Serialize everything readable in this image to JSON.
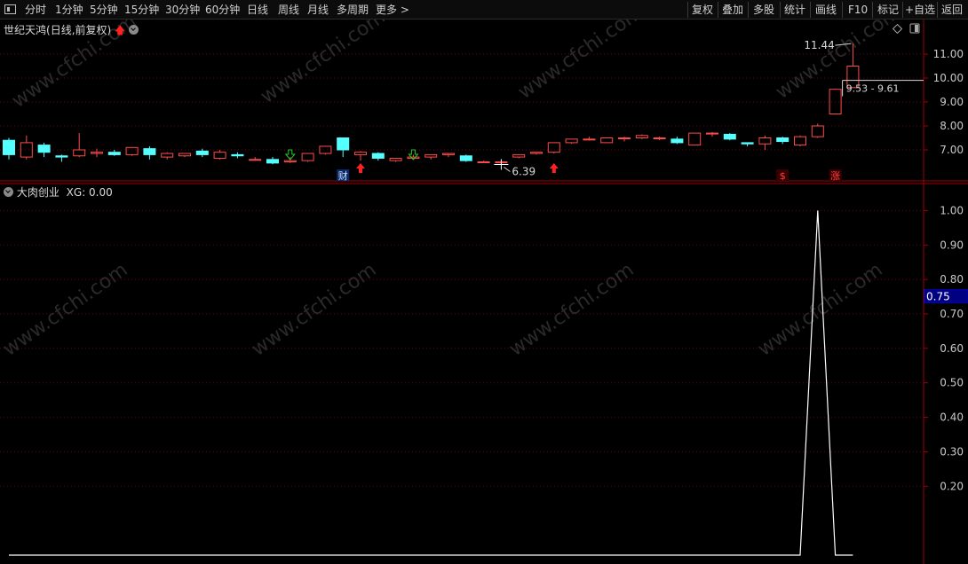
{
  "toolbar": {
    "items": [
      "分时",
      "1分钟",
      "5分钟",
      "15分钟",
      "30分钟",
      "60分钟",
      "日线",
      "周线",
      "月线",
      "多周期",
      "更多 >"
    ],
    "right_items": [
      "复权",
      "叠加",
      "多股",
      "统计",
      "画线",
      "F10",
      "标记",
      "+自选",
      "返回"
    ]
  },
  "main_panel": {
    "stock_name": "世纪天鸿",
    "period_label": "(日线,前复权)",
    "high_label": "11.44",
    "low_label": "6.39",
    "range_label": "9.53 - 9.61",
    "badge_cai": "财",
    "badge_dollar": "$",
    "badge_zhang": "涨"
  },
  "sub_panel": {
    "indicator_name": "大肉创业",
    "indicator_value": "XG: 0.00",
    "current_value_label": "0.75"
  },
  "watermark": "www.cfchi.com",
  "colors": {
    "up": "#ff4a4a",
    "down": "#54ffff",
    "line": "#ffffff",
    "axis": "#a0000a",
    "grid": "#6a0010"
  },
  "chart_data": [
    {
      "type": "candlestick",
      "title": "世纪天鸿(日线,前复权)",
      "ylim": [
        6.0,
        12.0
      ],
      "yticks": [
        "7.00",
        "8.00",
        "9.00",
        "10.00",
        "11.00"
      ],
      "annotations": [
        "11.44",
        "6.39",
        "9.53 - 9.61"
      ],
      "series": [
        {
          "o": 7.4,
          "h": 7.5,
          "l": 6.6,
          "c": 6.8
        },
        {
          "o": 6.7,
          "h": 7.6,
          "l": 6.6,
          "c": 7.3
        },
        {
          "o": 7.2,
          "h": 7.3,
          "l": 6.7,
          "c": 6.9
        },
        {
          "o": 6.75,
          "h": 6.8,
          "l": 6.5,
          "c": 6.7
        },
        {
          "o": 6.75,
          "h": 7.7,
          "l": 6.7,
          "c": 7.0
        },
        {
          "o": 6.85,
          "h": 7.05,
          "l": 6.7,
          "c": 6.9
        },
        {
          "o": 6.9,
          "h": 7.0,
          "l": 6.75,
          "c": 6.8
        },
        {
          "o": 6.8,
          "h": 7.1,
          "l": 6.75,
          "c": 7.1
        },
        {
          "o": 7.05,
          "h": 7.15,
          "l": 6.6,
          "c": 6.8
        },
        {
          "o": 6.7,
          "h": 6.9,
          "l": 6.6,
          "c": 6.85
        },
        {
          "o": 6.75,
          "h": 6.85,
          "l": 6.7,
          "c": 6.85
        },
        {
          "o": 6.95,
          "h": 7.05,
          "l": 6.7,
          "c": 6.8
        },
        {
          "o": 6.65,
          "h": 7.0,
          "l": 6.6,
          "c": 6.9
        },
        {
          "o": 6.8,
          "h": 6.9,
          "l": 6.65,
          "c": 6.75
        },
        {
          "o": 6.6,
          "h": 6.7,
          "l": 6.55,
          "c": 6.6
        },
        {
          "o": 6.6,
          "h": 6.7,
          "l": 6.4,
          "c": 6.45
        },
        {
          "o": 6.5,
          "h": 6.7,
          "l": 6.45,
          "c": 6.55
        },
        {
          "o": 6.55,
          "h": 6.85,
          "l": 6.5,
          "c": 6.85
        },
        {
          "o": 6.85,
          "h": 7.15,
          "l": 6.8,
          "c": 7.15
        },
        {
          "o": 7.5,
          "h": 7.5,
          "l": 6.7,
          "c": 7.0
        },
        {
          "o": 6.8,
          "h": 6.95,
          "l": 6.55,
          "c": 6.9
        },
        {
          "o": 6.85,
          "h": 6.9,
          "l": 6.55,
          "c": 6.65
        },
        {
          "o": 6.55,
          "h": 6.65,
          "l": 6.5,
          "c": 6.65
        },
        {
          "o": 6.65,
          "h": 6.8,
          "l": 6.6,
          "c": 6.7
        },
        {
          "o": 6.7,
          "h": 6.8,
          "l": 6.6,
          "c": 6.8
        },
        {
          "o": 6.8,
          "h": 6.85,
          "l": 6.7,
          "c": 6.85
        },
        {
          "o": 6.75,
          "h": 6.8,
          "l": 6.5,
          "c": 6.55
        },
        {
          "o": 6.5,
          "h": 6.55,
          "l": 6.45,
          "c": 6.5
        },
        {
          "o": 6.5,
          "h": 6.6,
          "l": 6.39,
          "c": 6.5
        },
        {
          "o": 6.7,
          "h": 6.8,
          "l": 6.65,
          "c": 6.8
        },
        {
          "o": 6.85,
          "h": 6.9,
          "l": 6.8,
          "c": 6.9
        },
        {
          "o": 6.9,
          "h": 7.3,
          "l": 6.85,
          "c": 7.3
        },
        {
          "o": 7.3,
          "h": 7.45,
          "l": 7.25,
          "c": 7.45
        },
        {
          "o": 7.45,
          "h": 7.55,
          "l": 7.4,
          "c": 7.45
        },
        {
          "o": 7.3,
          "h": 7.5,
          "l": 7.3,
          "c": 7.5
        },
        {
          "o": 7.5,
          "h": 7.55,
          "l": 7.35,
          "c": 7.5
        },
        {
          "o": 7.5,
          "h": 7.65,
          "l": 7.45,
          "c": 7.6
        },
        {
          "o": 7.5,
          "h": 7.55,
          "l": 7.4,
          "c": 7.5
        },
        {
          "o": 7.45,
          "h": 7.55,
          "l": 7.25,
          "c": 7.3
        },
        {
          "o": 7.2,
          "h": 7.7,
          "l": 7.2,
          "c": 7.7
        },
        {
          "o": 7.7,
          "h": 7.75,
          "l": 7.55,
          "c": 7.7
        },
        {
          "o": 7.65,
          "h": 7.7,
          "l": 7.4,
          "c": 7.45
        },
        {
          "o": 7.3,
          "h": 7.3,
          "l": 7.15,
          "c": 7.25
        },
        {
          "o": 7.25,
          "h": 7.6,
          "l": 7.0,
          "c": 7.5
        },
        {
          "o": 7.5,
          "h": 7.55,
          "l": 7.25,
          "c": 7.35
        },
        {
          "o": 7.2,
          "h": 7.6,
          "l": 7.15,
          "c": 7.55
        },
        {
          "o": 7.55,
          "h": 8.1,
          "l": 7.5,
          "c": 8.0
        },
        {
          "o": 8.5,
          "h": 9.55,
          "l": 8.5,
          "c": 9.53
        },
        {
          "o": 9.6,
          "h": 11.44,
          "l": 9.6,
          "c": 10.5
        }
      ]
    },
    {
      "type": "line",
      "title": "大肉创业",
      "ylim": [
        0.0,
        1.05
      ],
      "yticks": [
        "0.20",
        "0.30",
        "0.40",
        "0.50",
        "0.60",
        "0.70",
        "0.80",
        "0.90",
        "1.00"
      ],
      "series": [
        {
          "name": "XG",
          "values": [
            0,
            0,
            0,
            0,
            0,
            0,
            0,
            0,
            0,
            0,
            0,
            0,
            0,
            0,
            0,
            0,
            0,
            0,
            0,
            0,
            0,
            0,
            0,
            0,
            0,
            0,
            0,
            0,
            0,
            0,
            0,
            0,
            0,
            0,
            0,
            0,
            0,
            0,
            0,
            0,
            0,
            0,
            0,
            0,
            0,
            0,
            1,
            0,
            0
          ]
        }
      ]
    }
  ]
}
